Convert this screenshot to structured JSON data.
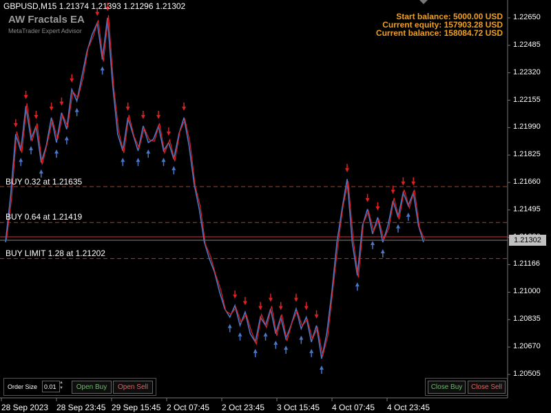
{
  "header": {
    "symbol": "GBPUSD,M15",
    "ohlc": "1.21374 1.21393 1.21296 1.21302"
  },
  "ea": {
    "title": "AW Fractals EA",
    "subtitle": "MetaTrader Expert Advisor"
  },
  "balance": {
    "start": "Start balance: 5000.00  USD",
    "equity": "Current equity: 157903.28  USD",
    "current": "Current balance: 158084.72  USD"
  },
  "levels": [
    {
      "label": "BUY 0.32 at 1.21635",
      "price": 1.21635
    },
    {
      "label": "BUY 0.64 at 1.21419",
      "price": 1.21419
    },
    {
      "label": "BUY LIMIT 1.28 at 1.21202",
      "price": 1.21202
    }
  ],
  "price_axis": [
    "1.22650",
    "1.22485",
    "1.22320",
    "1.22155",
    "1.21990",
    "1.21825",
    "1.21660",
    "1.21495",
    "1.21330",
    "1.21166",
    "1.21000",
    "1.20835",
    "1.20670",
    "1.20505"
  ],
  "current_price": "1.21302",
  "time_axis": [
    "28 Sep 2023",
    "28 Sep 23:45",
    "29 Sep 15:45",
    "2 Oct 07:45",
    "2 Oct 23:45",
    "3 Oct 15:45",
    "4 Oct 07:45",
    "4 Oct 23:45"
  ],
  "order_panel": {
    "size_label": "Order Size",
    "size_value": "0.01",
    "open_buy": "Open Buy",
    "open_sell": "Open Sell"
  },
  "close_panel": {
    "close_buy": "Close Buy",
    "close_sell": "Close Sell"
  },
  "colors": {
    "background": "#000000",
    "bull": "#e02020",
    "bear": "#4a78c8",
    "level_line": "#b04020",
    "balance_text": "#f0a020",
    "current_price_line": "#e03030"
  },
  "chart_data": {
    "type": "line",
    "ylim": [
      1.2042,
      1.2272
    ],
    "x_labels": [
      "28 Sep 2023",
      "28 Sep 23:45",
      "29 Sep 15:45",
      "2 Oct 07:45",
      "2 Oct 23:45",
      "3 Oct 15:45",
      "4 Oct 07:45",
      "4 Oct 23:45"
    ],
    "series": [
      {
        "values": [
          1.213,
          1.2158,
          1.2195,
          1.2185,
          1.2212,
          1.2192,
          1.22,
          1.2178,
          1.2188,
          1.2205,
          1.219,
          1.2208,
          1.2198,
          1.2222,
          1.2215,
          1.223,
          1.2245,
          1.2255,
          1.2262,
          1.224,
          1.2265,
          1.2225,
          1.2195,
          1.2185,
          1.2205,
          1.2195,
          1.2185,
          1.22,
          1.219,
          1.2192,
          1.22,
          1.2185,
          1.219,
          1.218,
          1.2195,
          1.2205,
          1.2188,
          1.2165,
          1.215,
          1.213,
          1.212,
          1.2112,
          1.21,
          1.209,
          1.2085,
          1.2092,
          1.208,
          1.2088,
          1.2075,
          1.207,
          1.2085,
          1.208,
          1.209,
          1.2075,
          1.2085,
          1.2072,
          1.208,
          1.209,
          1.2078,
          1.2085,
          1.207,
          1.208,
          1.206,
          1.2075,
          1.21,
          1.213,
          1.215,
          1.2168,
          1.213,
          1.211,
          1.214,
          1.215,
          1.2135,
          1.2145,
          1.213,
          1.214,
          1.2155,
          1.2145,
          1.216,
          1.2152,
          1.216,
          1.214,
          1.213
        ]
      }
    ]
  }
}
